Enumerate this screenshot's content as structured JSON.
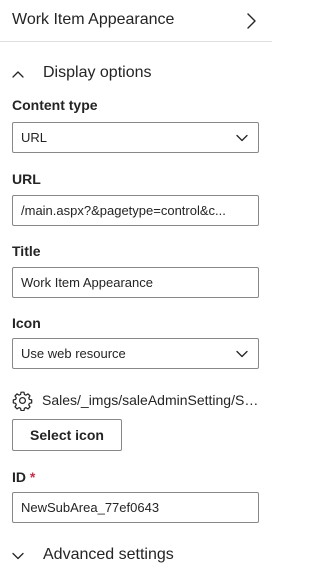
{
  "panel": {
    "title": "Work Item Appearance",
    "nav_icon": "chevron-right-icon"
  },
  "display_options": {
    "label": "Display options",
    "expanded": true,
    "toggle_icon": "chevron-up-icon"
  },
  "content_type": {
    "label": "Content type",
    "value": "URL",
    "dropdown_icon": "chevron-down-icon"
  },
  "url": {
    "label": "URL",
    "value": "/main.aspx?&pagetype=control&c..."
  },
  "title_field": {
    "label": "Title",
    "value": "Work Item Appearance"
  },
  "icon_field": {
    "label": "Icon",
    "value": "Use web resource",
    "dropdown_icon": "chevron-down-icon"
  },
  "selected_icon": {
    "icon": "gear-icon",
    "path": "Sales/_imgs/saleAdminSetting/Se..."
  },
  "select_icon_button": {
    "label": "Select icon"
  },
  "id_field": {
    "label": "ID",
    "required_marker": "*",
    "value": "NewSubArea_77ef0643"
  },
  "advanced_settings": {
    "label": "Advanced settings",
    "expanded": false,
    "toggle_icon": "chevron-down-icon"
  },
  "colors": {
    "text": "#242424",
    "border": "#8a8886",
    "required": "#c4314b",
    "divider": "#e1dfdd"
  }
}
